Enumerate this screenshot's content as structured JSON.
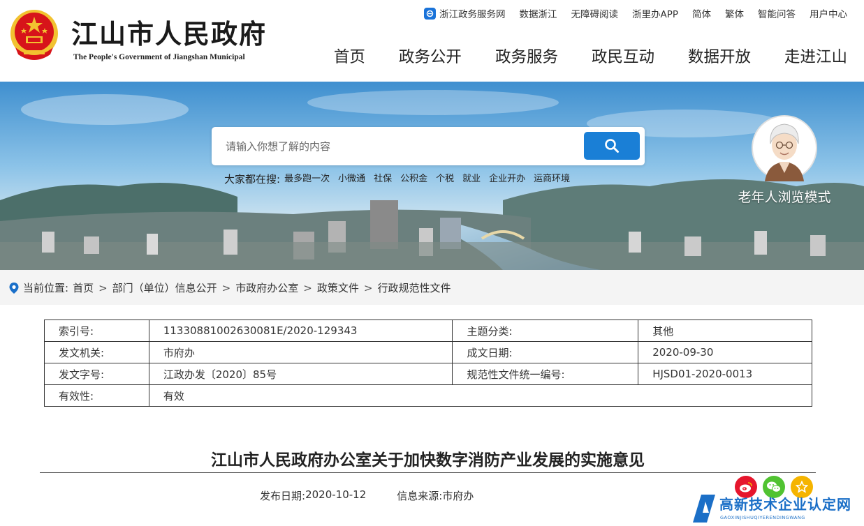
{
  "header": {
    "site_title": "江山市人民政府",
    "site_subtitle": "The People's Government of Jiangshan Municipal",
    "top_links": [
      "浙江政务服务网",
      "数据浙江",
      "无障碍阅读",
      "浙里办APP",
      "简体",
      "繁体",
      "智能问答",
      "用户中心"
    ],
    "nav": [
      "首页",
      "政务公开",
      "政务服务",
      "政民互动",
      "数据开放",
      "走进江山"
    ]
  },
  "search": {
    "placeholder": "请输入你想了解的内容",
    "hot_label": "大家都在搜:",
    "hot_items": [
      "最多跑一次",
      "小微通",
      "社保",
      "公积金",
      "个税",
      "就业",
      "企业开办",
      "运商环境"
    ]
  },
  "elder_mode": {
    "label": "老年人浏览模式"
  },
  "breadcrumb": {
    "label": "当前位置:",
    "items": [
      "首页",
      "部门（单位）信息公开",
      "市政府办公室",
      "政策文件",
      "行政规范性文件"
    ],
    "separator": ">"
  },
  "info_table": {
    "rows": [
      [
        "索引号:",
        "11330881002630081E/2020-129343",
        "主题分类:",
        "其他"
      ],
      [
        "发文机关:",
        "市府办",
        "成文日期:",
        "2020-09-30"
      ],
      [
        "发文字号:",
        "江政办发〔2020〕85号",
        "规范性文件统一编号:",
        "HJSD01-2020-0013"
      ],
      [
        "有效性:",
        "有效"
      ]
    ]
  },
  "article": {
    "title": "江山市人民政府办公室关于加快数字消防产业发展的实施意见",
    "publish_label": "发布日期:",
    "publish_date": "2020-10-12",
    "source_label": "信息来源:",
    "source": "市府办"
  },
  "watermark": {
    "text": "高新技术企业认定网",
    "sub": "GAOXINJISHUQIYERENDINGWANG"
  },
  "colors": {
    "accent_blue": "#1a7fd6",
    "weibo_red": "#e6162d",
    "wechat_green": "#51c332",
    "favorite_yellow": "#f5b400",
    "emblem_red": "#d7141a",
    "emblem_gold": "#f2c230"
  },
  "icons": [
    "national-emblem-icon",
    "zhejiang-service-icon",
    "search-icon",
    "elder-avatar-icon",
    "location-pin-icon",
    "weibo-icon",
    "wechat-icon",
    "star-icon",
    "watermark-logo-icon"
  ]
}
